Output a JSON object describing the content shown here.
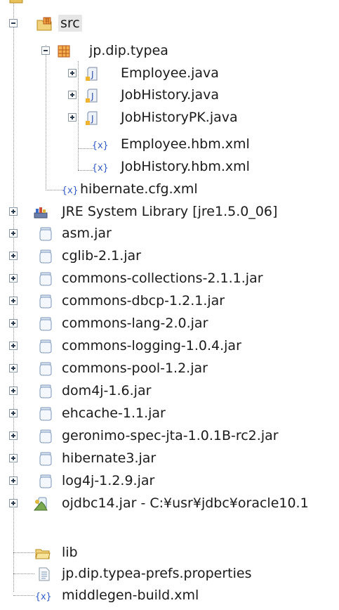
{
  "tree": {
    "src": "src",
    "package": "jp.dip.typea",
    "files": [
      {
        "label": "Employee.java"
      },
      {
        "label": "JobHistory.java"
      },
      {
        "label": "JobHistoryPK.java"
      },
      {
        "label": "Employee.hbm.xml"
      },
      {
        "label": "JobHistory.hbm.xml"
      }
    ],
    "hibernate_cfg": "hibernate.cfg.xml",
    "jre": "JRE System Library [jre1.5.0_06]",
    "jars": [
      "asm.jar",
      "cglib-2.1.jar",
      "commons-collections-2.1.1.jar",
      "commons-dbcp-1.2.1.jar",
      "commons-lang-2.0.jar",
      "commons-logging-1.0.4.jar",
      "commons-pool-1.2.jar",
      "dom4j-1.6.jar",
      "ehcache-1.1.jar",
      "geronimo-spec-jta-1.0.1B-rc2.jar",
      "hibernate3.jar",
      "log4j-1.2.9.jar"
    ],
    "ojdbc": "ojdbc14.jar - C:¥usr¥jdbc¥oracle10.1",
    "lib": "lib",
    "prefs": "jp.dip.typea-prefs.properties",
    "middlegen": "middlegen-build.xml"
  }
}
